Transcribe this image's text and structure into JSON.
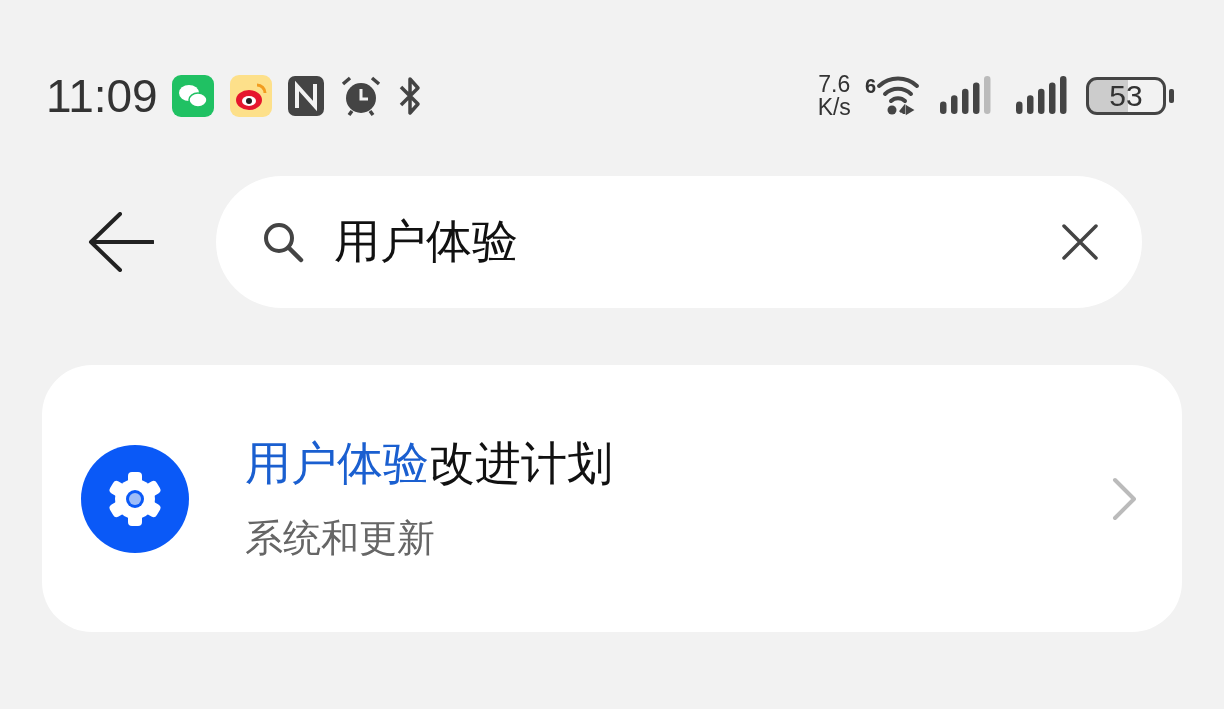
{
  "status_bar": {
    "time": "11:09",
    "speed_value": "7.6",
    "speed_unit": "K/s",
    "wifi_badge": "6",
    "battery": "53"
  },
  "search": {
    "value": "用户体验"
  },
  "results": [
    {
      "title_segments": [
        {
          "text": "用户体验",
          "highlighted": true
        },
        {
          "text": "改进计划",
          "highlighted": false
        }
      ],
      "subtitle": "系统和更新"
    }
  ]
}
